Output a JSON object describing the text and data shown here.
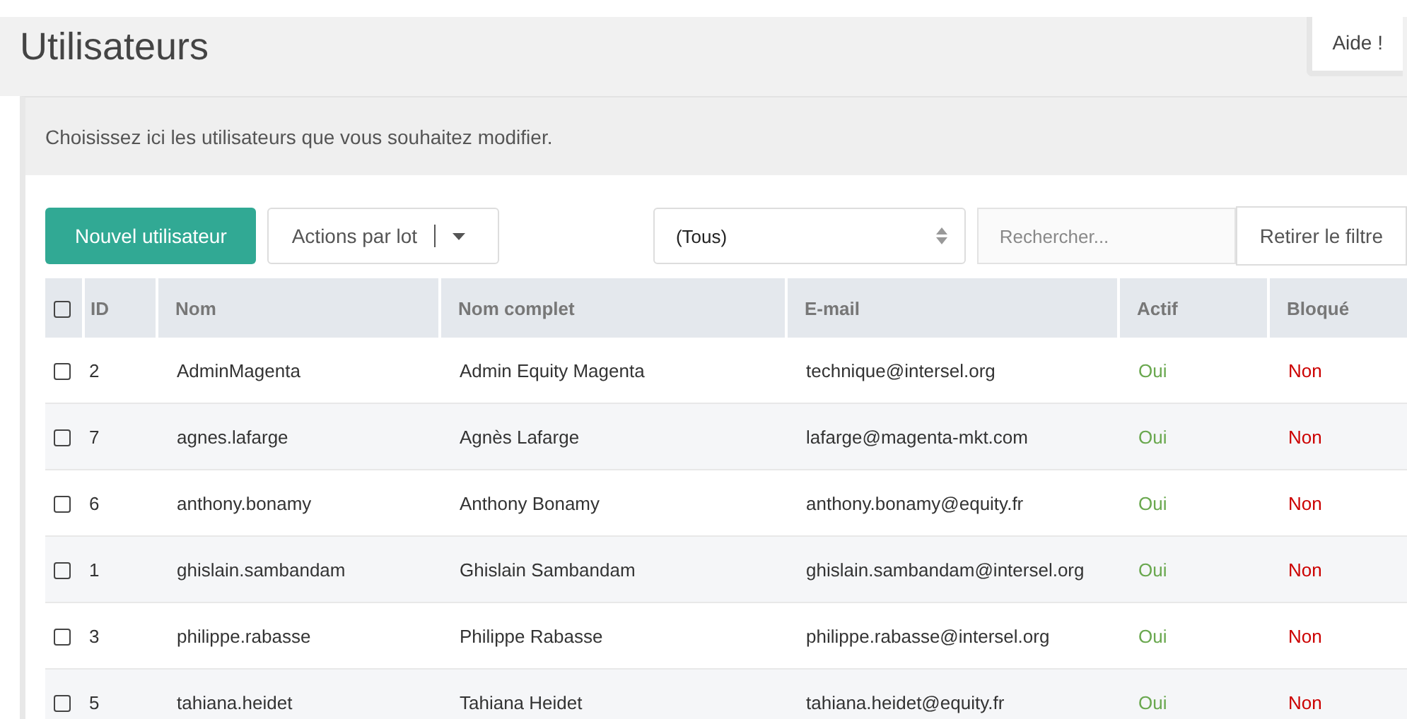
{
  "page_title": "Utilisateurs",
  "help_button": "Aide !",
  "panel": {
    "intro": "Choisissez ici les utilisateurs que vous souhaitez modifier."
  },
  "toolbar": {
    "new_button": "Nouvel utilisateur",
    "bulk_actions": "Actions par lot",
    "filter_select": "(Tous)",
    "search": {
      "placeholder": "Rechercher..."
    },
    "clear_filter": "Retirer le filtre"
  },
  "table": {
    "select_all_checked": false,
    "columns": [
      "ID",
      "Nom",
      "Nom complet",
      "E-mail",
      "Actif",
      "Bloqué"
    ],
    "rows": [
      {
        "checked": false,
        "id": "2",
        "nom": "AdminMagenta",
        "nom_complet": "Admin Equity Magenta",
        "email": "technique@intersel.org",
        "actif": {
          "text": "Oui",
          "on": true
        },
        "bloque": {
          "text": "Non",
          "on": false
        }
      },
      {
        "checked": false,
        "id": "7",
        "nom": "agnes.lafarge",
        "nom_complet": "Agnès Lafarge",
        "email": "lafarge@magenta-mkt.com",
        "actif": {
          "text": "Oui",
          "on": true
        },
        "bloque": {
          "text": "Non",
          "on": false
        }
      },
      {
        "checked": false,
        "id": "6",
        "nom": "anthony.bonamy",
        "nom_complet": "Anthony Bonamy",
        "email": "anthony.bonamy@equity.fr",
        "actif": {
          "text": "Oui",
          "on": true
        },
        "bloque": {
          "text": "Non",
          "on": false
        }
      },
      {
        "checked": false,
        "id": "1",
        "nom": "ghislain.sambandam",
        "nom_complet": "Ghislain Sambandam",
        "email": "ghislain.sambandam@intersel.org",
        "actif": {
          "text": "Oui",
          "on": true
        },
        "bloque": {
          "text": "Non",
          "on": false
        }
      },
      {
        "checked": false,
        "id": "3",
        "nom": "philippe.rabasse",
        "nom_complet": "Philippe Rabasse",
        "email": "philippe.rabasse@intersel.org",
        "actif": {
          "text": "Oui",
          "on": true
        },
        "bloque": {
          "text": "Non",
          "on": false
        }
      },
      {
        "checked": false,
        "id": "5",
        "nom": "tahiana.heidet",
        "nom_complet": "Tahiana Heidet",
        "email": "tahiana.heidet@equity.fr",
        "actif": {
          "text": "Oui",
          "on": true
        },
        "bloque": {
          "text": "Non",
          "on": false
        }
      }
    ]
  }
}
